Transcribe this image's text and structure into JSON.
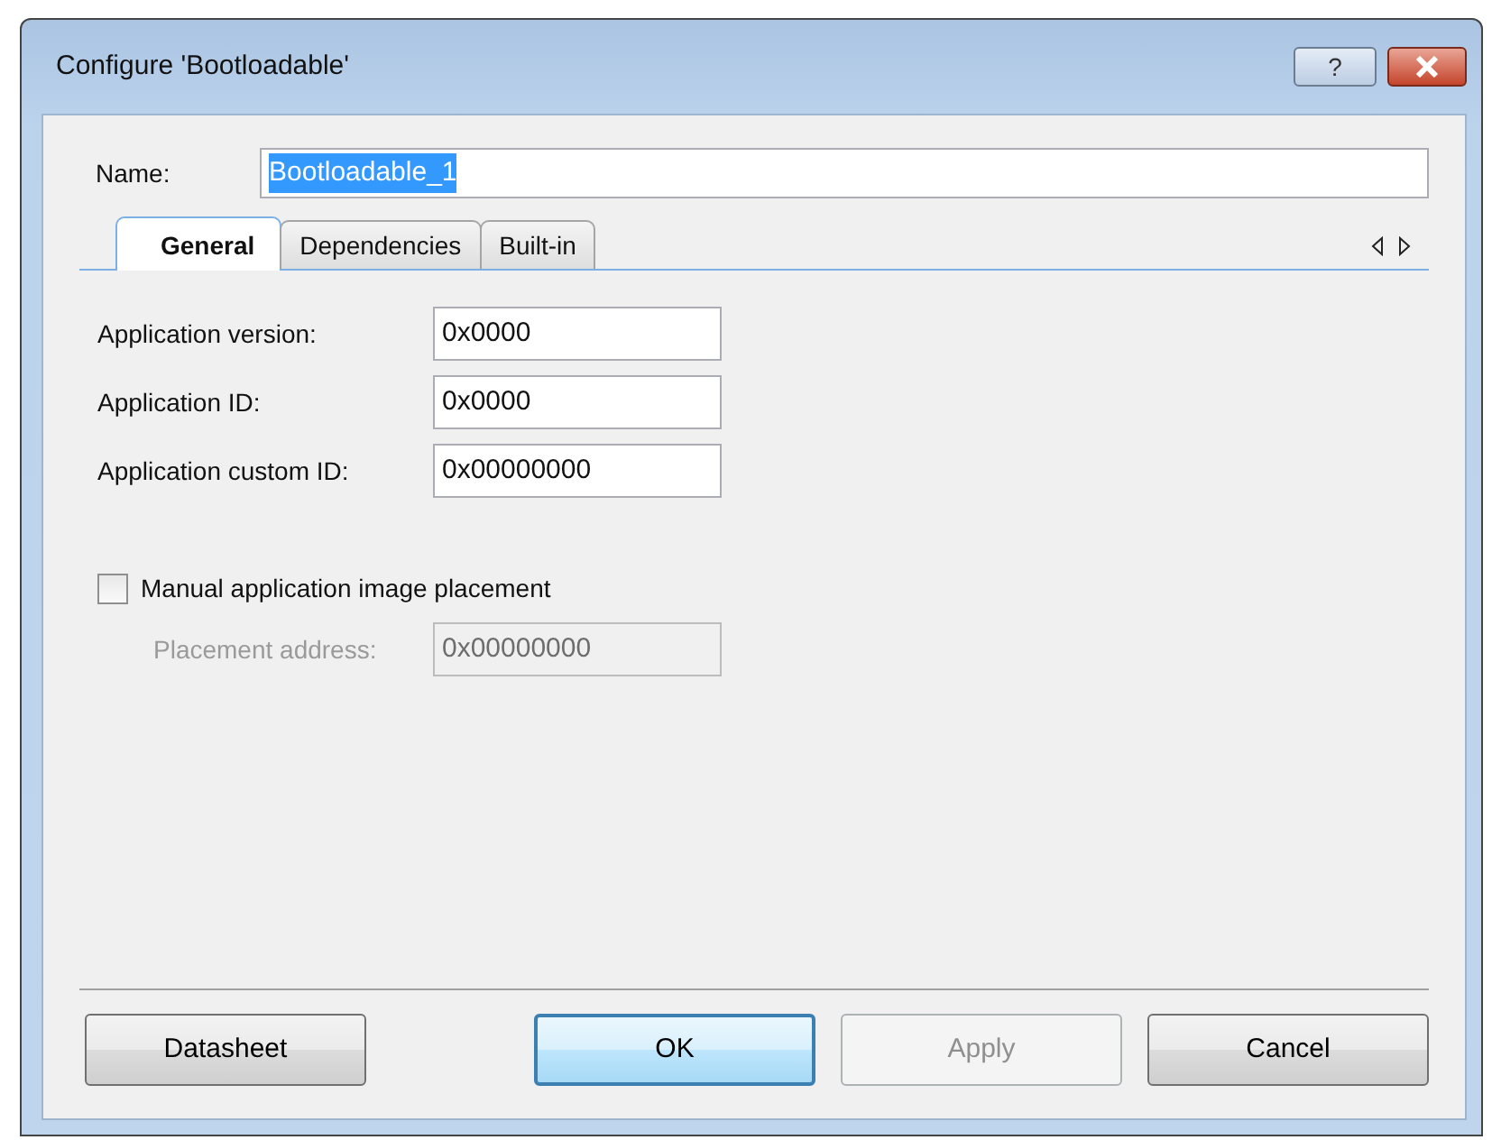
{
  "window": {
    "title": "Configure 'Bootloadable'",
    "help_button": "?"
  },
  "name_field": {
    "label": "Name:",
    "value": "Bootloadable_1",
    "text_selected": true
  },
  "tabs": [
    {
      "label": "General",
      "selected": true
    },
    {
      "label": "Dependencies",
      "selected": false
    },
    {
      "label": "Built-in",
      "selected": false
    }
  ],
  "fields": [
    {
      "label": "Application version:",
      "value": "0x0000",
      "disabled": false
    },
    {
      "label": "Application ID:",
      "value": "0x0000",
      "disabled": false
    },
    {
      "label": "Application custom ID:",
      "value": "0x00000000",
      "disabled": false
    }
  ],
  "checkbox": {
    "label": "Manual application image placement",
    "checked": false
  },
  "placement": {
    "label": "Placement address:",
    "value": "0x00000000",
    "disabled": true
  },
  "left_buttons": [
    {
      "label": "Datasheet",
      "disabled": false,
      "default": false
    }
  ],
  "right_buttons": [
    {
      "label": "OK",
      "disabled": false,
      "default": true
    },
    {
      "label": "Apply",
      "disabled": true,
      "default": false
    },
    {
      "label": "Cancel",
      "disabled": false,
      "default": false
    }
  ]
}
